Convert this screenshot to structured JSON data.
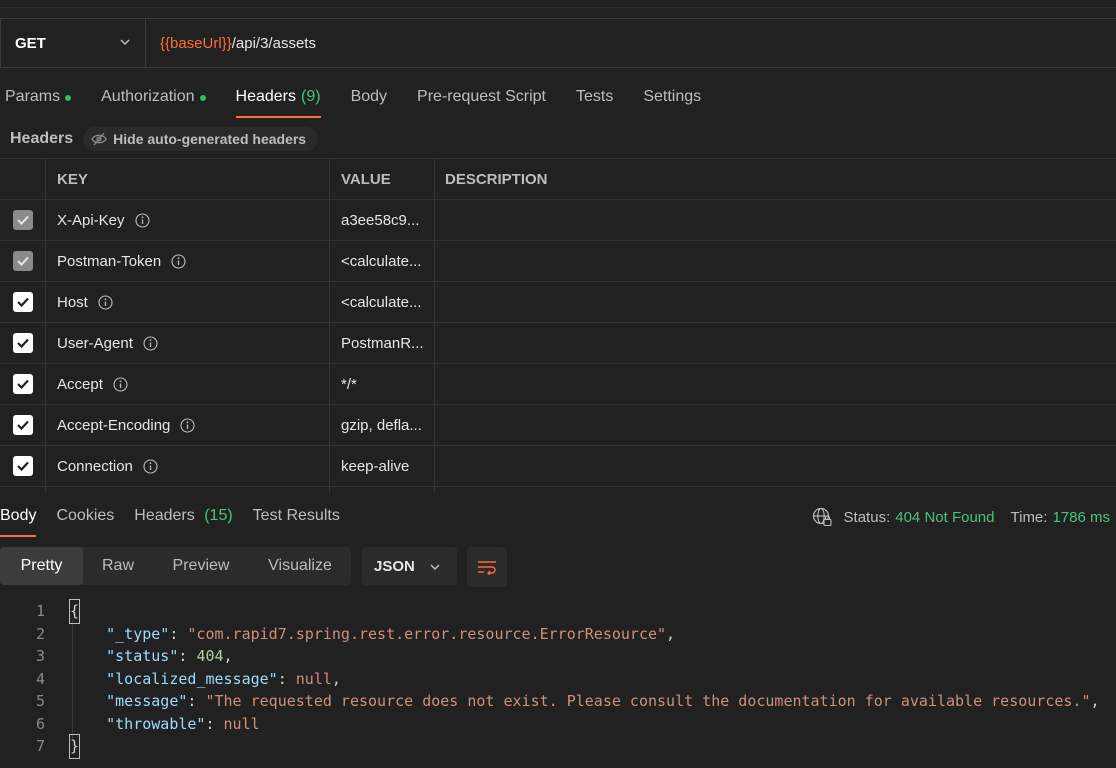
{
  "request": {
    "method": "GET",
    "url_var": "{{baseUrl}}",
    "url_path": "/api/3/assets"
  },
  "req_tabs": [
    {
      "label": "Params",
      "dot": true
    },
    {
      "label": "Authorization",
      "dot": true
    },
    {
      "label": "Headers",
      "count": "(9)",
      "active": true
    },
    {
      "label": "Body"
    },
    {
      "label": "Pre-request Script"
    },
    {
      "label": "Tests"
    },
    {
      "label": "Settings"
    }
  ],
  "headers_section": {
    "label": "Headers",
    "toggle_label": "Hide auto-generated headers"
  },
  "table": {
    "columns": [
      "KEY",
      "VALUE",
      "DESCRIPTION"
    ],
    "rows": [
      {
        "key": "X-Api-Key",
        "value": "a3ee58c9...",
        "locked": true
      },
      {
        "key": "Postman-Token",
        "value": "<calculate...",
        "locked": true
      },
      {
        "key": "Host",
        "value": "<calculate...",
        "locked": false
      },
      {
        "key": "User-Agent",
        "value": "PostmanR...",
        "locked": false
      },
      {
        "key": "Accept",
        "value": "*/*",
        "locked": false
      },
      {
        "key": "Accept-Encoding",
        "value": "gzip, defla...",
        "locked": false
      },
      {
        "key": "Connection",
        "value": "keep-alive",
        "locked": false
      }
    ]
  },
  "response": {
    "tabs": [
      {
        "label": "Body",
        "active": true
      },
      {
        "label": "Cookies"
      },
      {
        "label": "Headers",
        "count": "(15)"
      },
      {
        "label": "Test Results"
      }
    ],
    "status_label": "Status:",
    "status_value": "404 Not Found",
    "time_label": "Time:",
    "time_value": "1786 ms",
    "views": [
      "Pretty",
      "Raw",
      "Preview",
      "Visualize"
    ],
    "active_view": "Pretty",
    "format": "JSON"
  },
  "code": {
    "lines": [
      "1",
      "2",
      "3",
      "4",
      "5",
      "6",
      "7"
    ],
    "open_brace": "{",
    "close_brace": "}",
    "type_key": "\"_type\"",
    "type_value": "\"com.rapid7.spring.rest.error.resource.ErrorResource\"",
    "status_key": "\"status\"",
    "status_value": "404",
    "localized_key": "\"localized_message\"",
    "localized_value": "null",
    "message_key": "\"message\"",
    "message_value": "\"The requested resource does not exist. Please consult the documentation for available resources.\"",
    "throwable_key": "\"throwable\"",
    "throwable_value": "null"
  },
  "colors": {
    "accent": "#ff6c37",
    "success": "#49c477",
    "background": "#212121"
  }
}
